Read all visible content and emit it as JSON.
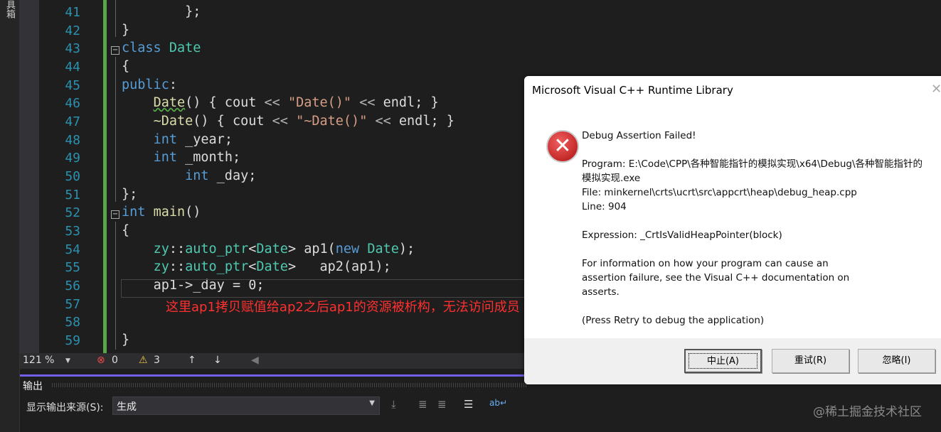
{
  "sidebar": {
    "toolbox_label": "具箱"
  },
  "editor": {
    "lines": [
      {
        "n": "41",
        "indent": "        ",
        "tokens": [
          [
            "};",
            "tx"
          ]
        ]
      },
      {
        "n": "42",
        "indent": "",
        "tokens": [
          [
            "}",
            "tx"
          ]
        ]
      },
      {
        "n": "43",
        "indent": "",
        "tokens": [
          [
            "class ",
            "kw"
          ],
          [
            "Date",
            "ty"
          ]
        ]
      },
      {
        "n": "44",
        "indent": "",
        "tokens": [
          [
            "{",
            "tx"
          ]
        ]
      },
      {
        "n": "45",
        "indent": "",
        "tokens": [
          [
            "public",
            "kw"
          ],
          [
            ":",
            "tx"
          ]
        ]
      },
      {
        "n": "46",
        "indent": "    ",
        "tokens": [
          [
            "Date",
            "fn"
          ],
          [
            "() { ",
            "tx"
          ],
          [
            "cout",
            "tx"
          ],
          [
            " << ",
            "op"
          ],
          [
            "\"Date()\"",
            "st"
          ],
          [
            " << ",
            "op"
          ],
          [
            "endl",
            "tx"
          ],
          [
            "; }",
            "tx"
          ]
        ]
      },
      {
        "n": "47",
        "indent": "    ",
        "tokens": [
          [
            "~Date",
            "fn"
          ],
          [
            "() { ",
            "tx"
          ],
          [
            "cout",
            "tx"
          ],
          [
            " << ",
            "op"
          ],
          [
            "\"~Date()\"",
            "st"
          ],
          [
            " << ",
            "op"
          ],
          [
            "endl",
            "tx"
          ],
          [
            "; }",
            "tx"
          ]
        ]
      },
      {
        "n": "48",
        "indent": "    ",
        "tokens": [
          [
            "int ",
            "kw"
          ],
          [
            "_year",
            "tx"
          ],
          [
            ";",
            "tx"
          ]
        ]
      },
      {
        "n": "49",
        "indent": "    ",
        "tokens": [
          [
            "int ",
            "kw"
          ],
          [
            "_month",
            "tx"
          ],
          [
            ";",
            "tx"
          ]
        ]
      },
      {
        "n": "50",
        "indent": "        ",
        "tokens": [
          [
            "int ",
            "kw"
          ],
          [
            "_day",
            "tx"
          ],
          [
            ";",
            "tx"
          ]
        ]
      },
      {
        "n": "51",
        "indent": "",
        "tokens": [
          [
            "};",
            "tx"
          ]
        ]
      },
      {
        "n": "52",
        "indent": "",
        "tokens": [
          [
            "int ",
            "kw"
          ],
          [
            "main",
            "fn"
          ],
          [
            "()",
            "tx"
          ]
        ]
      },
      {
        "n": "53",
        "indent": "",
        "tokens": [
          [
            "{",
            "tx"
          ]
        ]
      },
      {
        "n": "54",
        "indent": "    ",
        "tokens": [
          [
            "zy",
            "ty"
          ],
          [
            "::",
            "tx"
          ],
          [
            "auto_ptr",
            "ty"
          ],
          [
            "<",
            "tx"
          ],
          [
            "Date",
            "ty"
          ],
          [
            "> ",
            "tx"
          ],
          [
            "ap1",
            "tx"
          ],
          [
            "(",
            "tx"
          ],
          [
            "new ",
            "kw"
          ],
          [
            "Date",
            "ty"
          ],
          [
            ");",
            "tx"
          ]
        ]
      },
      {
        "n": "55",
        "indent": "    ",
        "tokens": [
          [
            "zy",
            "ty"
          ],
          [
            "::",
            "tx"
          ],
          [
            "auto_ptr",
            "ty"
          ],
          [
            "<",
            "tx"
          ],
          [
            "Date",
            "ty"
          ],
          [
            ">   ",
            "tx"
          ],
          [
            "ap2",
            "tx"
          ],
          [
            "(ap1);",
            "tx"
          ]
        ]
      },
      {
        "n": "56",
        "indent": "    ",
        "tokens": [
          [
            "ap1",
            "tx"
          ],
          [
            "->",
            "tx"
          ],
          [
            "_day",
            "tx"
          ],
          [
            " = ",
            "tx"
          ],
          [
            "0",
            "tx"
          ],
          [
            ";",
            "tx"
          ]
        ]
      },
      {
        "n": "57",
        "indent": "",
        "tokens": []
      },
      {
        "n": "58",
        "indent": "",
        "tokens": []
      },
      {
        "n": "59",
        "indent": "",
        "tokens": [
          [
            "}",
            "tx"
          ]
        ]
      }
    ],
    "annotation": "这里ap1拷贝赋值给ap2之后ap1的资源被析构，无法访问成员"
  },
  "statusbar": {
    "zoom": "121 %",
    "errors": "0",
    "warnings": "3"
  },
  "output": {
    "title": "输出",
    "source_label": "显示输出来源(S):",
    "source_value": "生成"
  },
  "watermark": "@稀土掘金技术社区",
  "dialog": {
    "title": "Microsoft Visual C++ Runtime Library",
    "heading": "Debug Assertion Failed!",
    "program": "Program: E:\\Code\\CPP\\各种智能指针的模拟实现\\x64\\Debug\\各种智能指针的模拟实现.exe",
    "file": "File: minkernel\\crts\\ucrt\\src\\appcrt\\heap\\debug_heap.cpp",
    "line": "Line: 904",
    "expression": "Expression: _CrtIsValidHeapPointer(block)",
    "info": "For information on how your program can cause an assertion failure, see the Visual C++ documentation on asserts.",
    "retry_hint": "(Press Retry to debug the application)",
    "buttons": {
      "abort": "中止(A)",
      "retry": "重试(R)",
      "ignore": "忽略(I)"
    }
  }
}
